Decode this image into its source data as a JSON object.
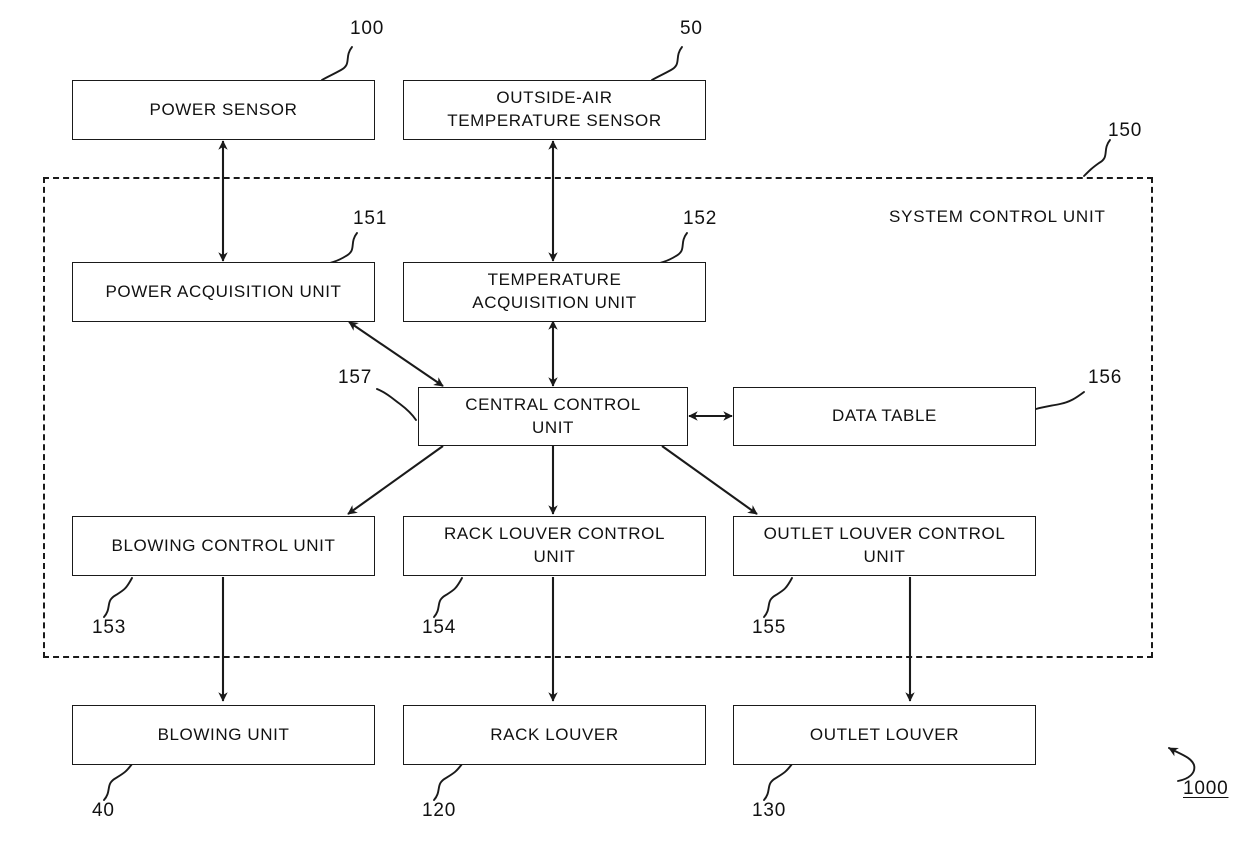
{
  "figure": {
    "title_ref": "1000",
    "boundary_label": "SYSTEM CONTROL UNIT",
    "boundary_ref": "150"
  },
  "boxes": {
    "power_sensor": {
      "label": "POWER SENSOR",
      "ref": "100"
    },
    "outside_air_temperature_sensor": {
      "label": "OUTSIDE-AIR\nTEMPERATURE SENSOR",
      "line1": "OUTSIDE-AIR",
      "line2": "TEMPERATURE SENSOR",
      "ref": "50"
    },
    "power_acquisition_unit": {
      "label": "POWER ACQUISITION UNIT",
      "ref": "151"
    },
    "temperature_acquisition_unit": {
      "line1": "TEMPERATURE",
      "line2": "ACQUISITION UNIT",
      "ref": "152"
    },
    "central_control_unit": {
      "line1": "CENTRAL CONTROL",
      "line2": "UNIT",
      "ref": "157"
    },
    "data_table": {
      "label": "DATA TABLE",
      "ref": "156"
    },
    "blowing_control_unit": {
      "label": "BLOWING CONTROL UNIT",
      "ref": "153"
    },
    "rack_louver_control_unit": {
      "line1": "RACK LOUVER CONTROL",
      "line2": "UNIT",
      "ref": "154"
    },
    "outlet_louver_control_unit": {
      "line1": "OUTLET LOUVER CONTROL",
      "line2": "UNIT",
      "ref": "155"
    },
    "blowing_unit": {
      "label": "BLOWING UNIT",
      "ref": "40"
    },
    "rack_louver": {
      "label": "RACK LOUVER",
      "ref": "120"
    },
    "outlet_louver": {
      "label": "OUTLET LOUVER",
      "ref": "130"
    }
  },
  "colors": {
    "stroke": "#1a1a1a",
    "text": "#111111",
    "background": "#ffffff"
  },
  "connections": [
    {
      "from": "power_sensor",
      "to": "power_acquisition_unit",
      "style": "double-arrow-vertical"
    },
    {
      "from": "outside_air_temperature_sensor",
      "to": "temperature_acquisition_unit",
      "style": "double-arrow-vertical"
    },
    {
      "from": "power_acquisition_unit",
      "to": "central_control_unit",
      "style": "double-arrow-diagonal"
    },
    {
      "from": "temperature_acquisition_unit",
      "to": "central_control_unit",
      "style": "double-arrow-vertical"
    },
    {
      "from": "central_control_unit",
      "to": "data_table",
      "style": "double-arrow-horizontal"
    },
    {
      "from": "central_control_unit",
      "to": "blowing_control_unit",
      "style": "arrow-diagonal"
    },
    {
      "from": "central_control_unit",
      "to": "rack_louver_control_unit",
      "style": "arrow-vertical"
    },
    {
      "from": "central_control_unit",
      "to": "outlet_louver_control_unit",
      "style": "arrow-diagonal"
    },
    {
      "from": "blowing_control_unit",
      "to": "blowing_unit",
      "style": "arrow-vertical"
    },
    {
      "from": "rack_louver_control_unit",
      "to": "rack_louver",
      "style": "arrow-vertical"
    },
    {
      "from": "outlet_louver_control_unit",
      "to": "outlet_louver",
      "style": "arrow-vertical"
    }
  ]
}
